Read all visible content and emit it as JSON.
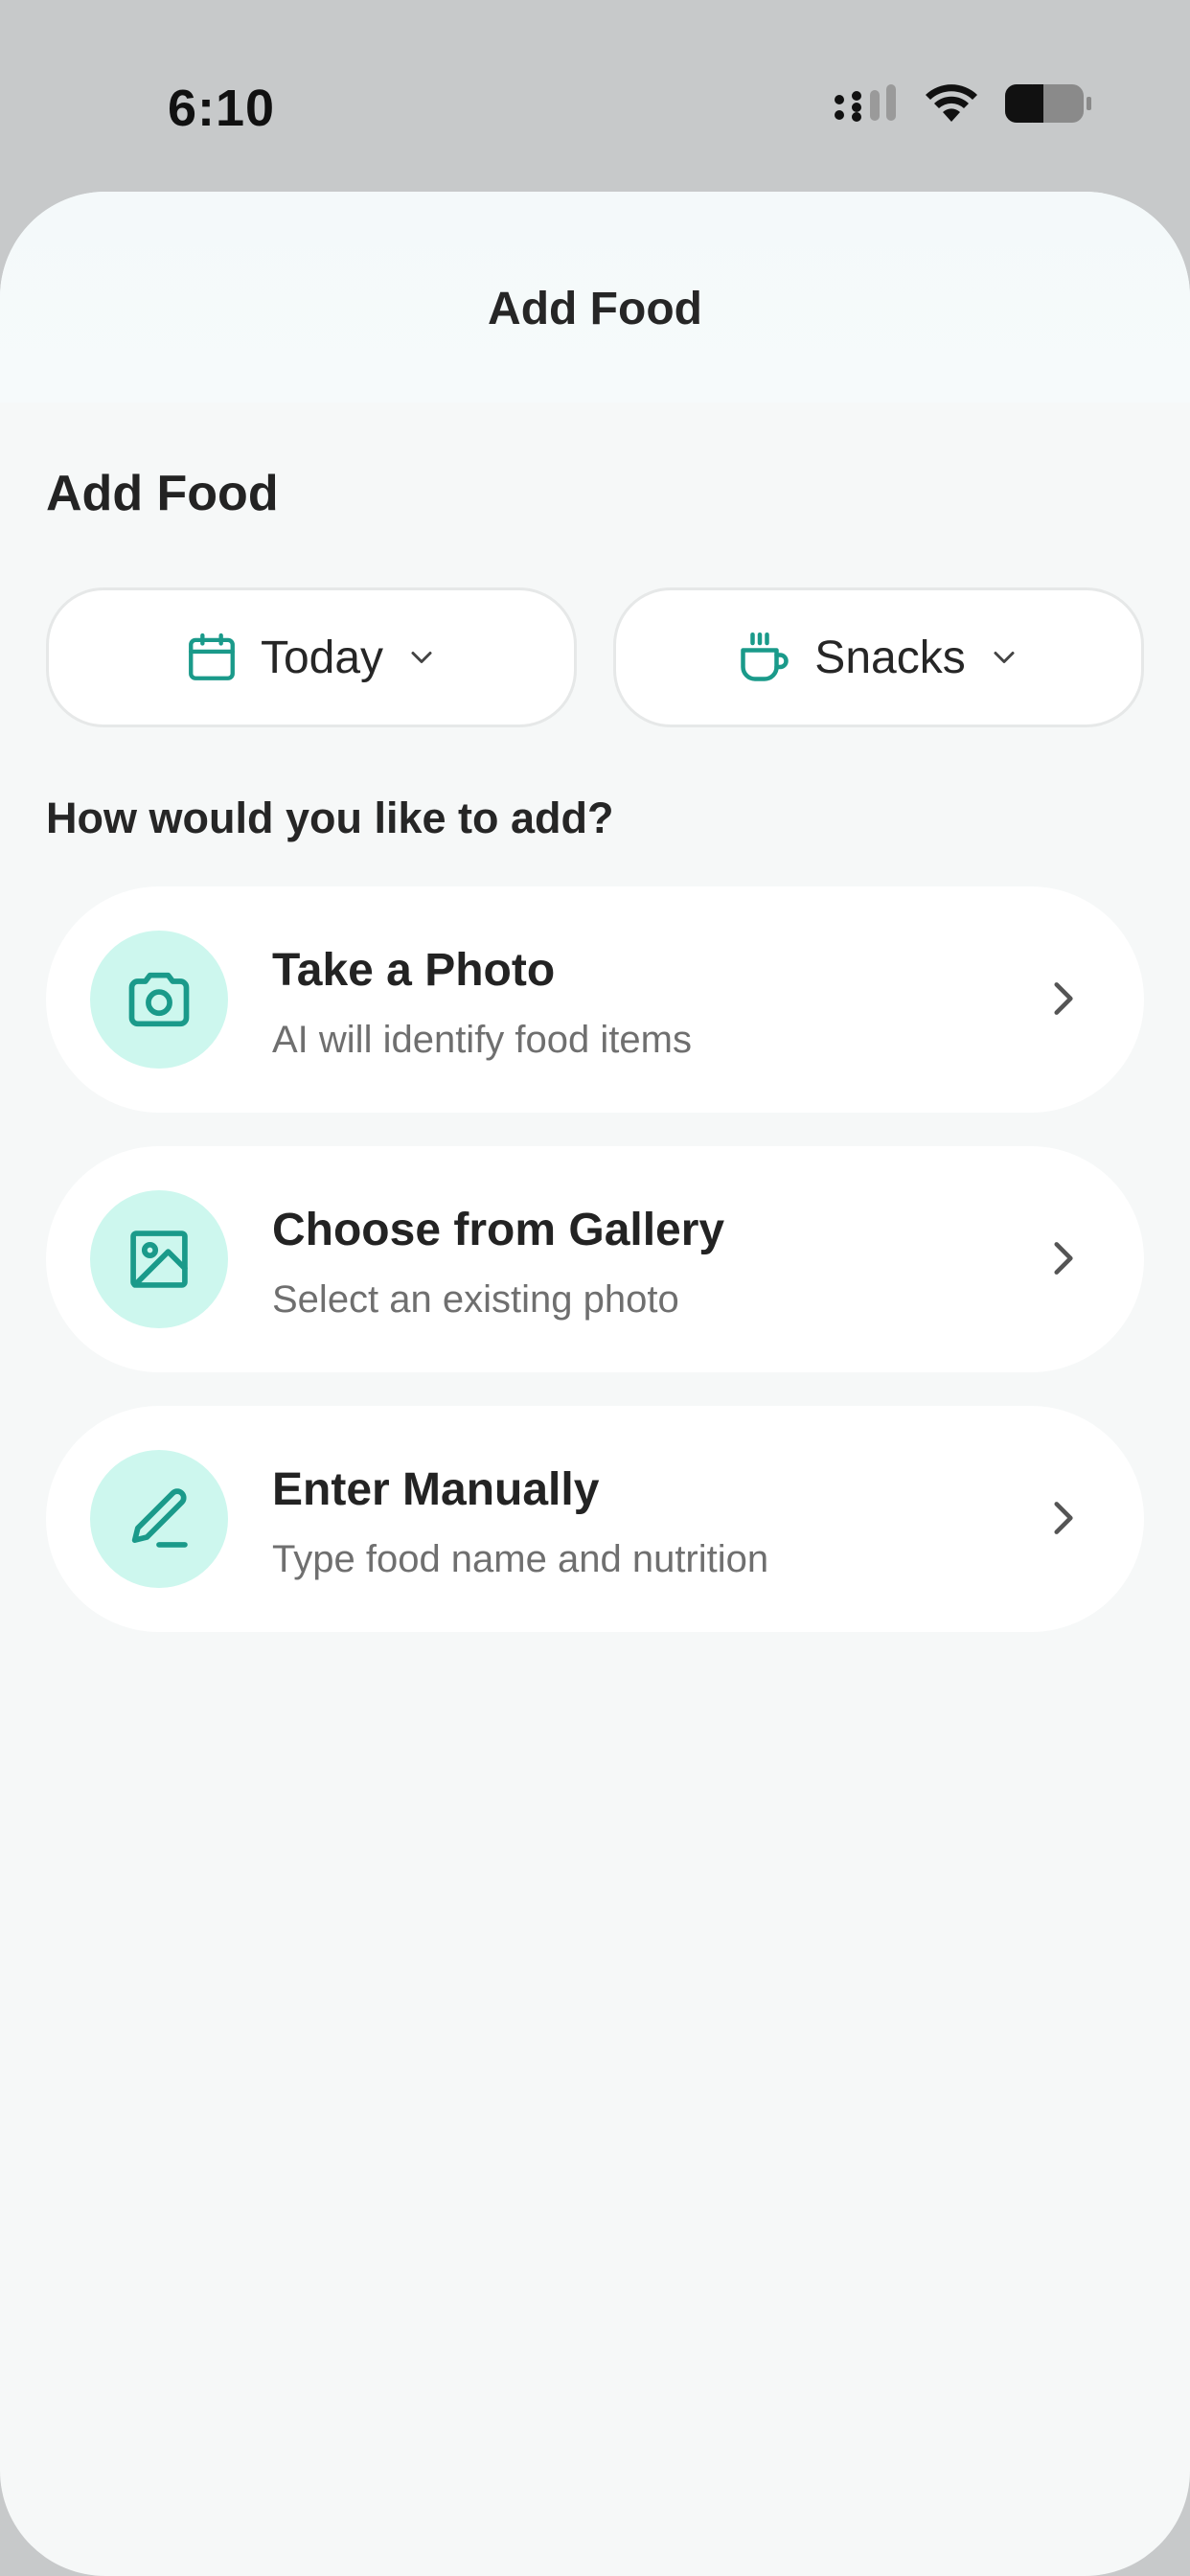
{
  "status": {
    "time": "6:10"
  },
  "header": {
    "title": "Add Food"
  },
  "section": {
    "title": "Add Food"
  },
  "selectors": {
    "date": {
      "label": "Today",
      "icon": "calendar-icon"
    },
    "meal": {
      "label": "Snacks",
      "icon": "cup-icon"
    }
  },
  "question": "How would you like to add?",
  "options": [
    {
      "title": "Take a Photo",
      "subtitle": "AI will identify food items",
      "icon": "camera-icon"
    },
    {
      "title": "Choose from Gallery",
      "subtitle": "Select an existing photo",
      "icon": "image-icon"
    },
    {
      "title": "Enter Manually",
      "subtitle": "Type food name and nutrition",
      "icon": "pencil-icon"
    }
  ],
  "colors": {
    "accent": "#1a9a8a",
    "icon_bg": "#cdf7ee",
    "background": "#f6f8f8",
    "status_bg": "#c7c9ca"
  }
}
